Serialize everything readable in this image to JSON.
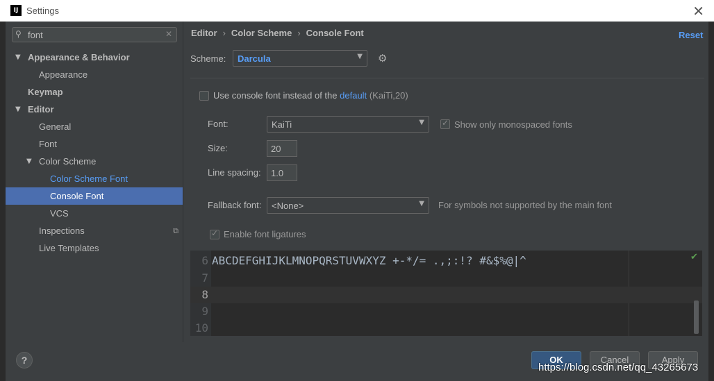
{
  "window": {
    "title": "Settings",
    "logo_text": "IJ"
  },
  "search": {
    "value": "font"
  },
  "sidebar": {
    "items": [
      {
        "label": "Appearance & Behavior",
        "expanded": true
      },
      {
        "label": "Appearance"
      },
      {
        "label": "Keymap"
      },
      {
        "label": "Editor",
        "expanded": true
      },
      {
        "label": "General"
      },
      {
        "label": "Font"
      },
      {
        "label": "Color Scheme",
        "expanded": true
      },
      {
        "label": "Color Scheme Font"
      },
      {
        "label": "Console Font",
        "selected": true
      },
      {
        "label": "VCS"
      },
      {
        "label": "Inspections"
      },
      {
        "label": "Live Templates"
      }
    ]
  },
  "breadcrumb": {
    "items": [
      "Editor",
      "Color Scheme",
      "Console Font"
    ]
  },
  "reset_label": "Reset",
  "scheme": {
    "label": "Scheme:",
    "value": "Darcula"
  },
  "use_console_font": {
    "label": "Use console font instead of the",
    "link": "default",
    "detail": "(KaiTi,20)",
    "checked": false
  },
  "font": {
    "label": "Font:",
    "value": "KaiTi"
  },
  "monospaced": {
    "label": "Show only monospaced fonts",
    "checked": true
  },
  "size": {
    "label": "Size:",
    "value": "20"
  },
  "line_spacing": {
    "label": "Line spacing:",
    "value": "1.0"
  },
  "fallback": {
    "label": "Fallback font:",
    "value": "<None>",
    "hint": "For symbols not supported by the main font"
  },
  "ligatures": {
    "label": "Enable font ligatures",
    "checked": true
  },
  "preview": {
    "lines": [
      {
        "num": "6",
        "text": "ABCDEFGHIJKLMNOPQRSTUVWXYZ +-*/= .,;:!? #&$%@|^"
      },
      {
        "num": "7",
        "text": ""
      },
      {
        "num": "8",
        "text": ""
      },
      {
        "num": "9",
        "text": ""
      },
      {
        "num": "10",
        "text": ""
      }
    ]
  },
  "footer": {
    "help": "?",
    "ok": "OK",
    "cancel": "Cancel",
    "apply": "Apply"
  },
  "watermark": "https://blog.csdn.net/qq_43265673",
  "colors": {
    "accent": "#4b6eaf",
    "link": "#589df6",
    "background": "#3c3f41",
    "editor_bg": "#2b2b2b"
  }
}
